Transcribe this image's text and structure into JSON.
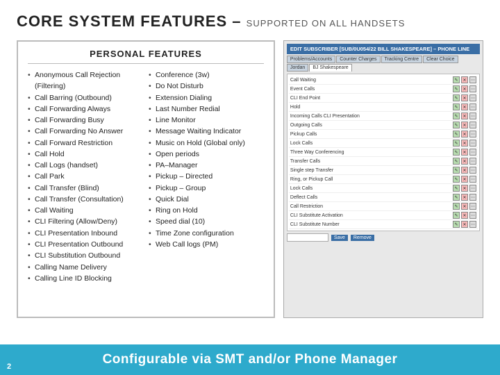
{
  "header": {
    "title": "CORE SYSTEM FEATURES –",
    "subtitle": "SUPPORTED ON ALL HANDSETS"
  },
  "personal_features": {
    "title": "PERSONAL FEATURES",
    "col1": [
      "Anonymous Call Rejection (Filtering)",
      "Call Barring (Outbound)",
      "Call Forwarding Always",
      "Call Forwarding Busy",
      "Call Forwarding No Answer",
      "Call Forward Restriction",
      "Call Hold",
      "Call Logs (handset)",
      "Call Park",
      "Call Transfer (Blind)",
      "Call Transfer (Consultation)",
      "Call Waiting",
      "CLI Filtering (Allow/Deny)",
      "CLI Presentation Inbound",
      "CLI Presentation Outbound",
      "CLI Substitution Outbound",
      "Calling Name Delivery",
      "Calling Line ID Blocking"
    ],
    "col2": [
      "Conference (3w)",
      "Do Not Disturb",
      "Extension Dialing",
      "Last Number Redial",
      "Line Monitor",
      "Message Waiting Indicator",
      "Music on Hold (Global only)",
      "Open periods",
      "PA–Manager",
      "Pickup – Directed",
      "Pickup – Group",
      "Quick Dial",
      "Ring on Hold",
      "Speed dial (10)",
      "Time Zone configuration",
      "Web Call logs (PM)"
    ]
  },
  "screenshot": {
    "header": "EDIT SUBSCRIBER [SUB/0U054/22 BILL SHAKESPEARE] – PHONE LINE",
    "tabs": [
      "Problems/Accounts",
      "Counter Charges",
      "Tracking Centre",
      "Clear Choice",
      "Jordan",
      "BJ Shakespeare"
    ],
    "rows": [
      {
        "label": "Call Waiting"
      },
      {
        "label": "Event Calls"
      },
      {
        "label": "CLI End Point"
      },
      {
        "label": "Hold"
      },
      {
        "label": "Incoming Calls CLI Presentation"
      },
      {
        "label": "Outgoing Calls"
      },
      {
        "label": "Pickup Calls"
      },
      {
        "label": "Lock Calls"
      },
      {
        "label": "Three Way Conferencing"
      },
      {
        "label": "Transfer Calls"
      },
      {
        "label": "Single step Transfer"
      },
      {
        "label": "Ring, or Pickup Call"
      },
      {
        "label": "Lock Calls"
      },
      {
        "label": "Deflect Calls"
      },
      {
        "label": "Call Restriction"
      },
      {
        "label": "CLI Substitute Activation"
      },
      {
        "label": "CLI Substitute Number"
      }
    ]
  },
  "footer": {
    "text": "Configurable via SMT and/or Phone Manager",
    "page_num": "2"
  }
}
